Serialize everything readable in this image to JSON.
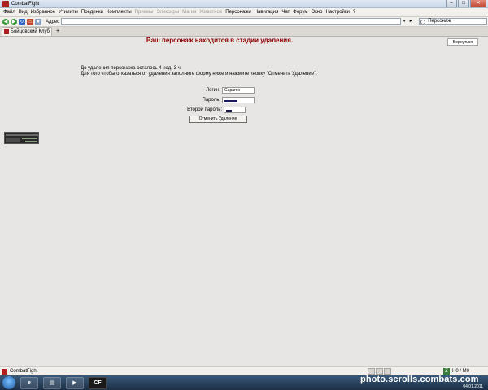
{
  "window": {
    "title": "CombatFight",
    "minimize": "–",
    "maximize": "□",
    "close": "✕"
  },
  "menu": [
    {
      "label": "Файл",
      "disabled": false
    },
    {
      "label": "Вид",
      "disabled": false
    },
    {
      "label": "Избранное",
      "disabled": false
    },
    {
      "label": "Утилиты",
      "disabled": false
    },
    {
      "label": "Поединки",
      "disabled": false
    },
    {
      "label": "Комплекты",
      "disabled": false
    },
    {
      "label": "Приемы",
      "disabled": true
    },
    {
      "label": "Эликсиры",
      "disabled": true
    },
    {
      "label": "Магия",
      "disabled": true
    },
    {
      "label": "Животное",
      "disabled": true
    },
    {
      "label": "Персонажи",
      "disabled": false
    },
    {
      "label": "Навигация",
      "disabled": false
    },
    {
      "label": "Чат",
      "disabled": false
    },
    {
      "label": "Форум",
      "disabled": false
    },
    {
      "label": "Окно",
      "disabled": false
    },
    {
      "label": "Настройки",
      "disabled": false
    },
    {
      "label": "?",
      "disabled": false
    }
  ],
  "addressbar": {
    "label": "Адрес",
    "value": "",
    "search_value": "Персонаж"
  },
  "tabs": [
    {
      "label": "Бойцовский Клуб"
    }
  ],
  "page": {
    "title": "Ваш персонаж находится в стадии удаления.",
    "return_label": "Вернуться",
    "info_line1": "До удаления персонажа осталось 4 нед. 3 ч.",
    "info_line2": "Для того чтобы отказаться от удаления заполните форму ниже и нажмите кнопку \"Отменить Удаление\".",
    "login_label": "Логин:",
    "login_value": "Сарагон",
    "password_label": "Пароль:",
    "second_password_label": "Второй пароль:",
    "cancel_label": "Отменить Удаление"
  },
  "statusbar": {
    "title": "CombatFight",
    "counter": "H0 / M0"
  },
  "taskbar": {
    "cf_label": "CF",
    "date": "04.01.2011",
    "watermark": "photo.scrolls.combats.com"
  }
}
